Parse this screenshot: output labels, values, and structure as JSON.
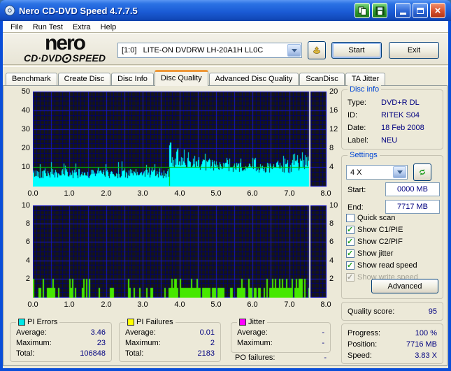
{
  "window": {
    "title": "Nero CD-DVD Speed 4.7.7.5"
  },
  "menu": {
    "items": [
      "File",
      "Run Test",
      "Extra",
      "Help"
    ]
  },
  "header": {
    "logo_top": "nero",
    "logo_bottom_left": "CD·DVD",
    "logo_bottom_right": "SPEED",
    "drive_selector_value": "[1:0]   LITE-ON DVDRW LH-20A1H LL0C",
    "start_button": "Start",
    "exit_button": "Exit"
  },
  "tabs": {
    "items": [
      "Benchmark",
      "Create Disc",
      "Disc Info",
      "Disc Quality",
      "Advanced Disc Quality",
      "ScanDisc",
      "TA Jitter"
    ],
    "active_index": 3
  },
  "disc_info": {
    "title": "Disc info",
    "rows": [
      {
        "label": "Type:",
        "value": "DVD+R DL"
      },
      {
        "label": "ID:",
        "value": "RITEK S04"
      },
      {
        "label": "Date:",
        "value": "18 Feb 2008"
      },
      {
        "label": "Label:",
        "value": "NEU"
      }
    ]
  },
  "settings": {
    "title": "Settings",
    "speed_value": "4 X",
    "start_label": "Start:",
    "start_value": "0000 MB",
    "end_label": "End:",
    "end_value": "7717 MB",
    "checkboxes": [
      {
        "label": "Quick scan",
        "checked": false,
        "disabled": false
      },
      {
        "label": "Show C1/PIE",
        "checked": true,
        "disabled": false
      },
      {
        "label": "Show C2/PIF",
        "checked": true,
        "disabled": false
      },
      {
        "label": "Show jitter",
        "checked": true,
        "disabled": false
      },
      {
        "label": "Show read speed",
        "checked": true,
        "disabled": false
      },
      {
        "label": "Show write speed",
        "checked": true,
        "disabled": true
      }
    ],
    "advanced_button": "Advanced"
  },
  "quality": {
    "label": "Quality score:",
    "value": "95"
  },
  "progress": {
    "rows": [
      {
        "label": "Progress:",
        "value": "100 %"
      },
      {
        "label": "Position:",
        "value": "7716 MB"
      },
      {
        "label": "Speed:",
        "value": "3.83 X"
      }
    ]
  },
  "stats": {
    "pi_errors": {
      "title": "PI Errors",
      "color": "#00E6E6",
      "rows": [
        {
          "label": "Average:",
          "value": "3.46"
        },
        {
          "label": "Maximum:",
          "value": "23"
        },
        {
          "label": "Total:",
          "value": "106848"
        }
      ]
    },
    "pi_failures": {
      "title": "PI Failures",
      "color": "#FFFF00",
      "rows": [
        {
          "label": "Average:",
          "value": "0.01"
        },
        {
          "label": "Maximum:",
          "value": "2"
        },
        {
          "label": "Total:",
          "value": "2183"
        }
      ]
    },
    "jitter": {
      "title": "Jitter",
      "color": "#FF00FF",
      "rows": [
        {
          "label": "Average:",
          "value": "-"
        },
        {
          "label": "Maximum:",
          "value": "-"
        }
      ],
      "extra": {
        "label": "PO failures:",
        "value": "-"
      }
    }
  },
  "chart_data": [
    {
      "name": "PI Errors scan",
      "type": "area",
      "x_min": 0,
      "x_max": 8,
      "x_ticks": [
        0,
        1,
        2,
        3,
        4,
        5,
        6,
        7,
        8
      ],
      "x_tick_labels": [
        "0.0",
        "1.0",
        "2.0",
        "3.0",
        "4.0",
        "5.0",
        "6.0",
        "7.0",
        "8.0"
      ],
      "y_left": {
        "min": 0,
        "max": 50,
        "ticks": [
          50,
          40,
          30,
          20,
          10
        ],
        "minor": 2.5,
        "major": 10
      },
      "y_right": {
        "min": 0,
        "max": 20,
        "ticks": [
          20,
          16,
          12,
          8,
          4
        ]
      },
      "x_grid": {
        "minor": 0.1,
        "major": 0.5
      },
      "series_color": "#00FFFF",
      "seed": 42,
      "data_end": 7.55,
      "segments": [
        {
          "from": 0.0,
          "to": 3.72,
          "base": 6.5,
          "noise": 2.5,
          "spike_chance": 0.12,
          "spike_min": 9,
          "spike_max": 13
        },
        {
          "from": 3.72,
          "to": 3.82,
          "base": 15,
          "noise": 5,
          "spike_chance": 0.4,
          "spike_min": 16,
          "spike_max": 23
        },
        {
          "from": 3.82,
          "to": 4.55,
          "base": 13,
          "noise": 3.5,
          "spike_chance": 0.25,
          "spike_min": 15,
          "spike_max": 20
        },
        {
          "from": 4.55,
          "to": 5.2,
          "base": 11,
          "noise": 3,
          "spike_chance": 0.2,
          "spike_min": 13,
          "spike_max": 17
        },
        {
          "from": 5.2,
          "to": 7.05,
          "base": 9.5,
          "noise": 2.8,
          "spike_chance": 0.15,
          "spike_min": 12,
          "spike_max": 16
        },
        {
          "from": 7.05,
          "to": 7.45,
          "base": 11,
          "noise": 3,
          "spike_chance": 0.3,
          "spike_min": 13,
          "spike_max": 18
        },
        {
          "from": 7.45,
          "to": 7.56,
          "base": 14,
          "noise": 4,
          "spike_chance": 0.5,
          "spike_min": 16,
          "spike_max": 21
        }
      ],
      "peaks": [
        {
          "x": 3.74,
          "v": 23
        }
      ],
      "read_speed": {
        "color": "#00C800",
        "value": 4,
        "axis_max": 20,
        "dip_x": 3.72
      },
      "marker": {
        "x": 7.55,
        "color": "#E0E0E0"
      },
      "average": 3.46,
      "maximum": 23,
      "total": 106848
    },
    {
      "name": "PI Failures scan",
      "type": "bars",
      "x_min": 0,
      "x_max": 8,
      "x_ticks": [
        0,
        1,
        2,
        3,
        4,
        5,
        6,
        7,
        8
      ],
      "x_tick_labels": [
        "0.0",
        "1.0",
        "2.0",
        "3.0",
        "4.0",
        "5.0",
        "6.0",
        "7.0",
        "8.0"
      ],
      "y_left": {
        "min": 0,
        "max": 10,
        "ticks": [
          10,
          8,
          6,
          4,
          2
        ],
        "minor": 0.5,
        "major": 2
      },
      "y_right": {
        "min": 0,
        "max": 10,
        "ticks": [
          10,
          8,
          6,
          4,
          2
        ]
      },
      "x_grid": {
        "minor": 0.1,
        "major": 0.5
      },
      "bar_color": "#46E800",
      "seed": 7,
      "data_end": 7.55,
      "segments": [
        {
          "from": 0.0,
          "to": 0.55,
          "density": 0.5,
          "two_chance": 0.3
        },
        {
          "from": 0.55,
          "to": 1.0,
          "density": 0.25,
          "two_chance": 0.2
        },
        {
          "from": 1.0,
          "to": 1.75,
          "density": 0.4,
          "two_chance": 0.25
        },
        {
          "from": 1.75,
          "to": 2.2,
          "density": 0.55,
          "two_chance": 0.2
        },
        {
          "from": 2.2,
          "to": 3.05,
          "density": 0.3,
          "two_chance": 0.12
        },
        {
          "from": 3.05,
          "to": 3.7,
          "density": 0.4,
          "two_chance": 0.12
        },
        {
          "from": 3.7,
          "to": 4.55,
          "density": 0.97,
          "two_chance": 0.28
        },
        {
          "from": 4.55,
          "to": 5.25,
          "density": 0.85,
          "two_chance": 0.22
        },
        {
          "from": 5.25,
          "to": 5.55,
          "density": 0.35,
          "two_chance": 0.08
        },
        {
          "from": 5.55,
          "to": 6.6,
          "density": 0.75,
          "two_chance": 0.15
        },
        {
          "from": 6.6,
          "to": 7.56,
          "density": 0.88,
          "two_chance": 0.22
        }
      ],
      "marker": {
        "x": 7.55,
        "color": "#E0E0E0"
      },
      "average": 0.01,
      "maximum": 2,
      "total": 2183
    }
  ]
}
